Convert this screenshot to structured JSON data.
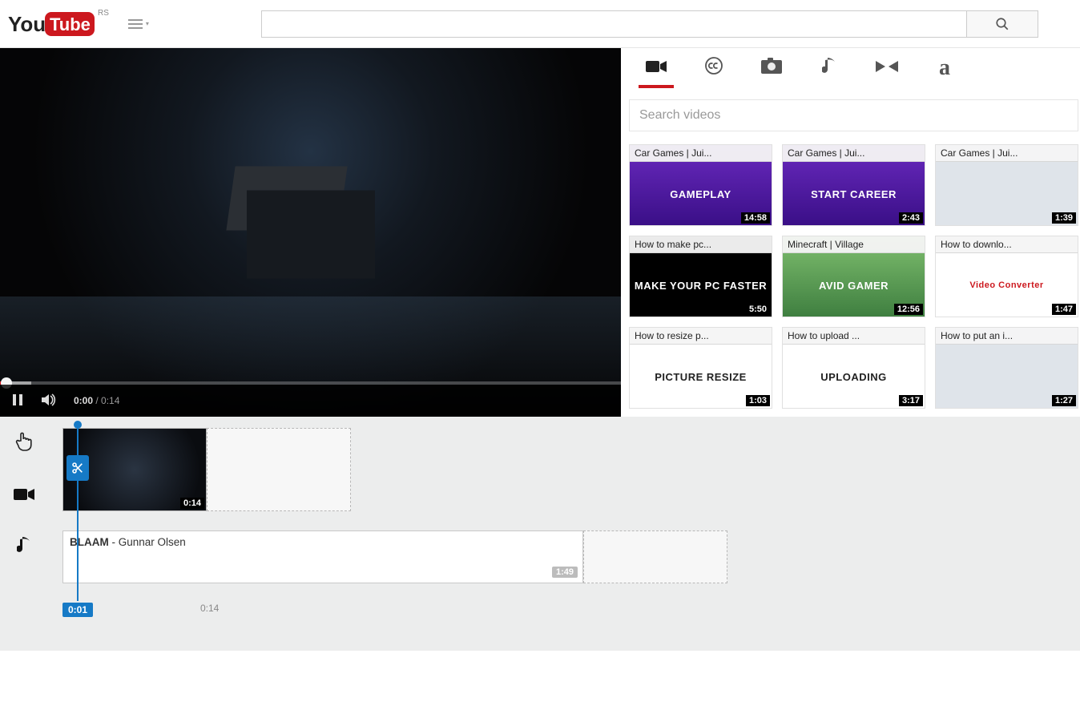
{
  "header": {
    "logo_country": "RS",
    "search_value": "",
    "search_placeholder": ""
  },
  "player": {
    "current_time": "0:00",
    "duration": "0:14"
  },
  "side": {
    "search_placeholder": "Search videos",
    "thumbs": [
      {
        "title": "Car Games | Jui...",
        "duration": "14:58",
        "overlay": "GAMEPLAY",
        "style": "bg-juiced"
      },
      {
        "title": "Car Games | Jui...",
        "duration": "2:43",
        "overlay": "START CAREER",
        "style": "bg-juiced"
      },
      {
        "title": "Car Games | Jui...",
        "duration": "1:39",
        "overlay": "",
        "style": "bg-grey"
      },
      {
        "title": "How to make pc...",
        "duration": "5:50",
        "overlay": "MAKE YOUR PC FASTER",
        "style": "bg-black"
      },
      {
        "title": "Minecraft | Village",
        "duration": "12:56",
        "overlay": "AVID GAMER",
        "style": "bg-mc"
      },
      {
        "title": "How to downlo...",
        "duration": "1:47",
        "overlay": "Video Converter",
        "style": "bg-white",
        "badge": true
      },
      {
        "title": "How to resize p...",
        "duration": "1:03",
        "overlay": "PICTURE RESIZE",
        "style": "bg-white"
      },
      {
        "title": "How to upload ...",
        "duration": "3:17",
        "overlay": "UPLOADING",
        "style": "bg-white"
      },
      {
        "title": "How to put an i...",
        "duration": "1:27",
        "overlay": "",
        "style": "bg-grey"
      }
    ]
  },
  "timeline": {
    "playhead_label": "0:01",
    "video_clip_duration": "0:14",
    "audio_clip": {
      "title": "BLAAM",
      "artist": "Gunnar Olsen",
      "duration": "1:49"
    },
    "duration_tick": "0:14"
  }
}
